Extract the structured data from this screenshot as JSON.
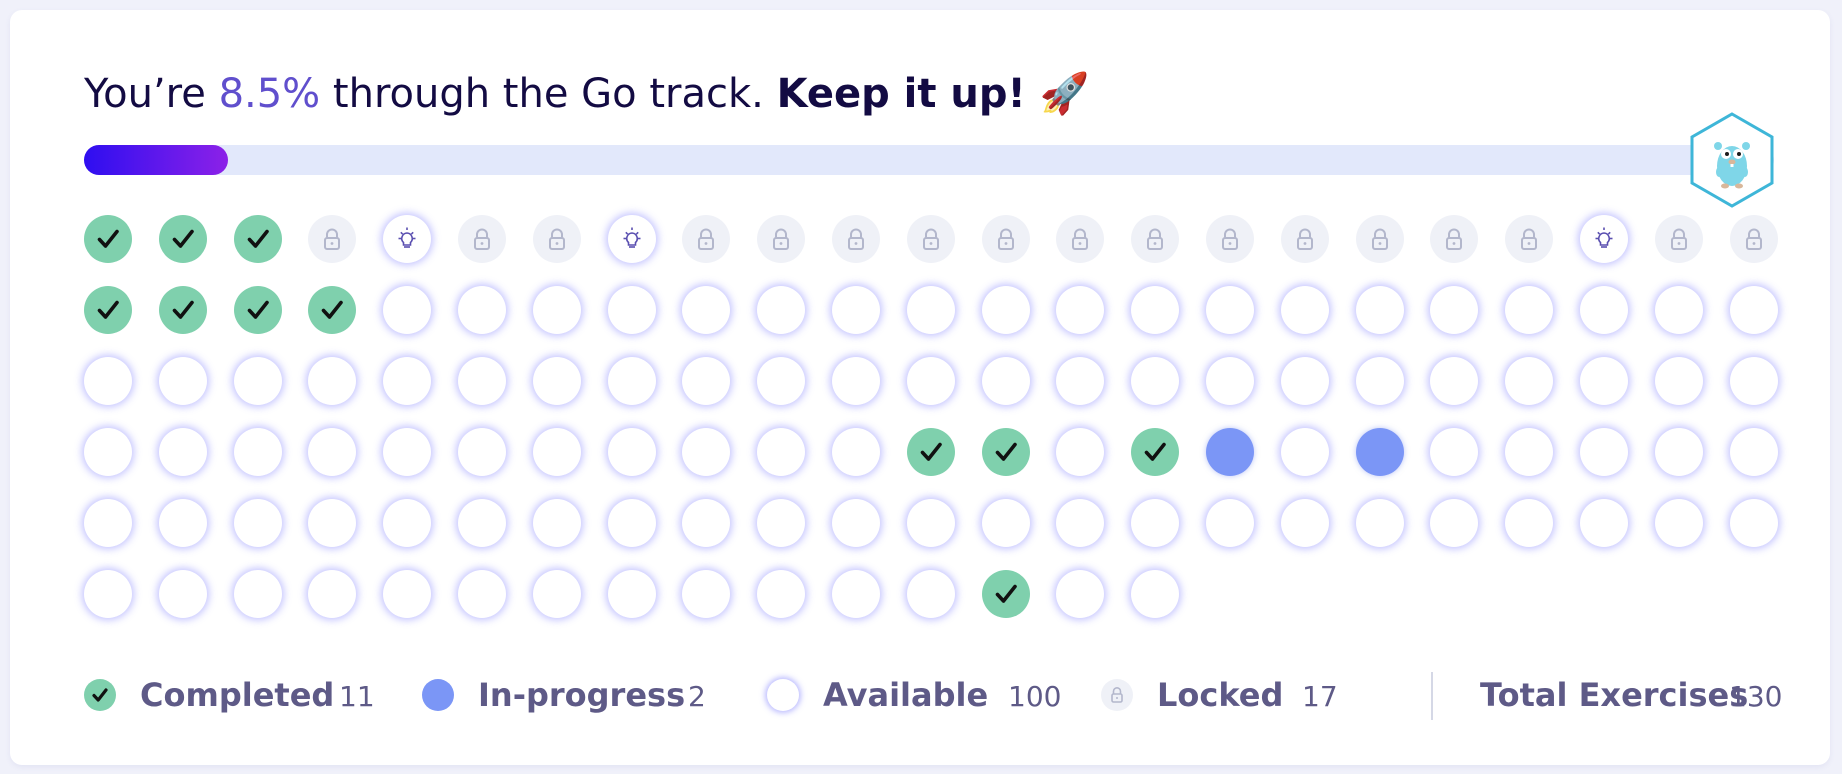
{
  "headline": {
    "prefix": "You’re ",
    "percent": "8.5%",
    "middle": " through the Go track. ",
    "cheer": "Keep it up! 🚀"
  },
  "progress": {
    "fraction": 0.085
  },
  "track": {
    "icon": "go-gopher-icon"
  },
  "colors": {
    "completed": "#7fd0ad",
    "in_progress": "#7b96f6",
    "available": "#ffffff",
    "locked": "#eff1f7",
    "accent": "#604fcd",
    "progress_gradient": [
      "#2e0ef0",
      "#8c21e8"
    ]
  },
  "exercise_grid": {
    "columns": 23,
    "rows": [
      [
        "completed",
        "completed",
        "completed",
        "locked",
        "hint",
        "locked",
        "locked",
        "hint",
        "locked",
        "locked",
        "locked",
        "locked",
        "locked",
        "locked",
        "locked",
        "locked",
        "locked",
        "locked",
        "locked",
        "locked",
        "hint",
        "locked",
        "locked"
      ],
      [
        "completed",
        "completed",
        "completed",
        "completed",
        "available",
        "available",
        "available",
        "available",
        "available",
        "available",
        "available",
        "available",
        "available",
        "available",
        "available",
        "available",
        "available",
        "available",
        "available",
        "available",
        "available",
        "available",
        "available"
      ],
      [
        "available",
        "available",
        "available",
        "available",
        "available",
        "available",
        "available",
        "available",
        "available",
        "available",
        "available",
        "available",
        "available",
        "available",
        "available",
        "available",
        "available",
        "available",
        "available",
        "available",
        "available",
        "available",
        "available"
      ],
      [
        "available",
        "available",
        "available",
        "available",
        "available",
        "available",
        "available",
        "available",
        "available",
        "available",
        "available",
        "completed",
        "completed",
        "available",
        "completed",
        "in-progress",
        "available",
        "in-progress",
        "available",
        "available",
        "available",
        "available",
        "available"
      ],
      [
        "available",
        "available",
        "available",
        "available",
        "available",
        "available",
        "available",
        "available",
        "available",
        "available",
        "available",
        "available",
        "available",
        "available",
        "available",
        "available",
        "available",
        "available",
        "available",
        "available",
        "available",
        "available",
        "available"
      ],
      [
        "available",
        "available",
        "available",
        "available",
        "available",
        "available",
        "available",
        "available",
        "available",
        "available",
        "available",
        "available",
        "completed",
        "available",
        "available"
      ]
    ]
  },
  "legend": {
    "completed": {
      "label": "Completed",
      "count": "11"
    },
    "in_progress": {
      "label": "In-progress",
      "count": "2"
    },
    "available": {
      "label": "Available",
      "count": "100"
    },
    "locked": {
      "label": "Locked",
      "count": "17"
    },
    "total": {
      "label": "Total Exercises",
      "count": "130"
    }
  }
}
